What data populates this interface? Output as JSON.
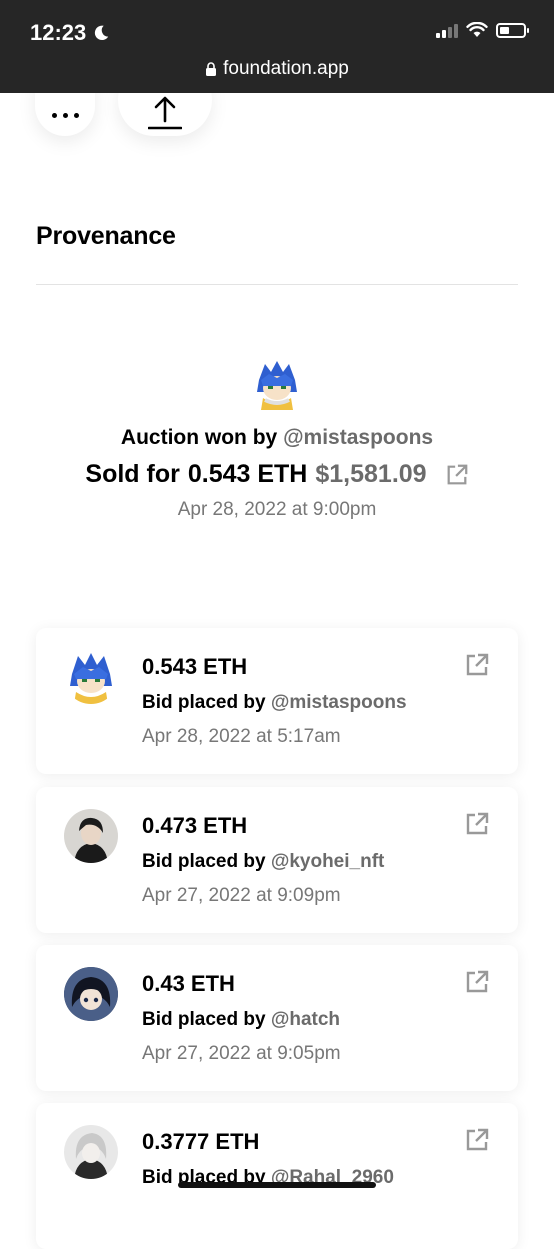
{
  "status_bar": {
    "time": "12:23",
    "url": "foundation.app"
  },
  "icons": {
    "more": "more-icon",
    "share": "share-icon",
    "external": "external-link-icon",
    "lock": "lock-icon",
    "moon": "moon-icon"
  },
  "provenance": {
    "heading": "Provenance",
    "auction": {
      "won_label": "Auction won by",
      "winner": "@mistaspoons",
      "sold_label": "Sold for",
      "eth": "0.543 ETH",
      "usd": "$1,581.09",
      "date": "Apr 28, 2022 at 9:00pm"
    },
    "bids": [
      {
        "amount": "0.543 ETH",
        "by_label": "Bid placed by",
        "handle": "@mistaspoons",
        "date": "Apr 28, 2022 at 5:17am"
      },
      {
        "amount": "0.473 ETH",
        "by_label": "Bid placed by",
        "handle": "@kyohei_nft",
        "date": "Apr 27, 2022 at 9:09pm"
      },
      {
        "amount": "0.43 ETH",
        "by_label": "Bid placed by",
        "handle": "@hatch",
        "date": "Apr 27, 2022 at 9:05pm"
      },
      {
        "amount": "0.3777 ETH",
        "by_label": "Bid placed by",
        "handle": "@Rahal_2960",
        "date": ""
      }
    ]
  },
  "colors": {
    "topbar_bg": "#262626",
    "muted_text": "#6b6b6b",
    "date_text": "#777777"
  }
}
